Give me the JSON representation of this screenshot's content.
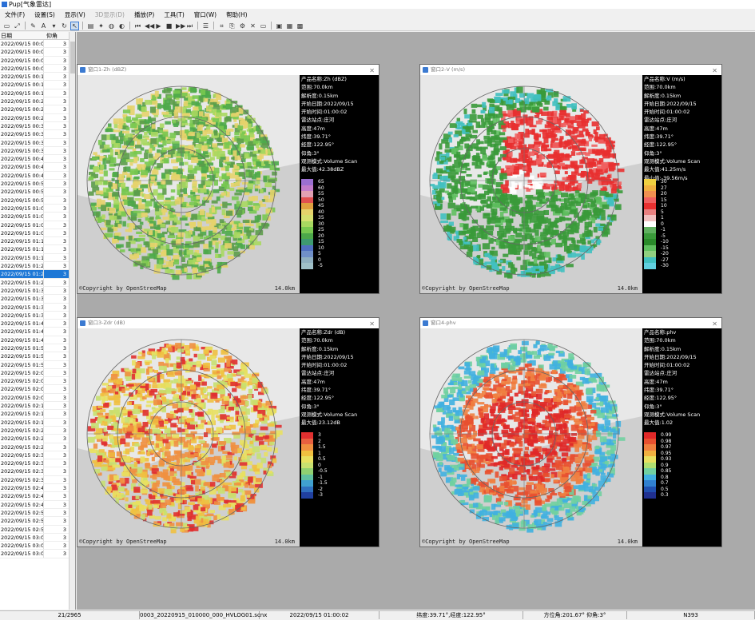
{
  "window_title": "Pup[气象雷达]",
  "menu": [
    "文件(F)",
    "设置(S)",
    "显示(V)",
    "3D显示(D)",
    "播放(P)",
    "工具(T)",
    "窗口(W)",
    "帮助(H)"
  ],
  "menu_disabled": [
    false,
    false,
    false,
    true,
    false,
    false,
    false,
    false
  ],
  "list": {
    "col_date": "日期",
    "col_elev": "仰角",
    "selected_index": 28,
    "rows": [
      [
        "2022/09/15 00:00",
        "3"
      ],
      [
        "2022/09/15 00:03",
        "3"
      ],
      [
        "2022/09/15 00:06",
        "3"
      ],
      [
        "2022/09/15 00:09",
        "3"
      ],
      [
        "2022/09/15 00:12",
        "3"
      ],
      [
        "2022/09/15 00:15",
        "3"
      ],
      [
        "2022/09/15 00:18",
        "3"
      ],
      [
        "2022/09/15 00:21",
        "3"
      ],
      [
        "2022/09/15 00:24",
        "3"
      ],
      [
        "2022/09/15 00:27",
        "3"
      ],
      [
        "2022/09/15 00:30",
        "3"
      ],
      [
        "2022/09/15 00:33",
        "3"
      ],
      [
        "2022/09/15 00:36",
        "3"
      ],
      [
        "2022/09/15 00:39",
        "3"
      ],
      [
        "2022/09/15 00:42",
        "3"
      ],
      [
        "2022/09/15 00:45",
        "3"
      ],
      [
        "2022/09/15 00:48",
        "3"
      ],
      [
        "2022/09/15 00:51",
        "3"
      ],
      [
        "2022/09/15 00:54",
        "3"
      ],
      [
        "2022/09/15 00:57",
        "3"
      ],
      [
        "2022/09/15 01:00",
        "3"
      ],
      [
        "2022/09/15 01:03",
        "3"
      ],
      [
        "2022/09/15 01:06",
        "3"
      ],
      [
        "2022/09/15 01:09",
        "3"
      ],
      [
        "2022/09/15 01:12",
        "3"
      ],
      [
        "2022/09/15 01:15",
        "3"
      ],
      [
        "2022/09/15 01:18",
        "3"
      ],
      [
        "2022/09/15 01:21",
        "3"
      ],
      [
        "2022/09/15 01:24",
        "3"
      ],
      [
        "2022/09/15 01:27",
        "3"
      ],
      [
        "2022/09/15 01:30",
        "3"
      ],
      [
        "2022/09/15 01:33",
        "3"
      ],
      [
        "2022/09/15 01:36",
        "3"
      ],
      [
        "2022/09/15 01:39",
        "3"
      ],
      [
        "2022/09/15 01:42",
        "3"
      ],
      [
        "2022/09/15 01:45",
        "3"
      ],
      [
        "2022/09/15 01:48",
        "3"
      ],
      [
        "2022/09/15 01:51",
        "3"
      ],
      [
        "2022/09/15 01:54",
        "3"
      ],
      [
        "2022/09/15 01:57",
        "3"
      ],
      [
        "2022/09/15 02:00",
        "3"
      ],
      [
        "2022/09/15 02:03",
        "3"
      ],
      [
        "2022/09/15 02:06",
        "3"
      ],
      [
        "2022/09/15 02:09",
        "3"
      ],
      [
        "2022/09/15 02:12",
        "3"
      ],
      [
        "2022/09/15 02:15",
        "3"
      ],
      [
        "2022/09/15 02:18",
        "3"
      ],
      [
        "2022/09/15 02:21",
        "3"
      ],
      [
        "2022/09/15 02:24",
        "3"
      ],
      [
        "2022/09/15 02:27",
        "3"
      ],
      [
        "2022/09/15 02:30",
        "3"
      ],
      [
        "2022/09/15 02:33",
        "3"
      ],
      [
        "2022/09/15 02:36",
        "3"
      ],
      [
        "2022/09/15 02:39",
        "3"
      ],
      [
        "2022/09/15 02:42",
        "3"
      ],
      [
        "2022/09/15 02:45",
        "3"
      ],
      [
        "2022/09/15 02:48",
        "3"
      ],
      [
        "2022/09/15 02:51",
        "3"
      ],
      [
        "2022/09/15 02:54",
        "3"
      ],
      [
        "2022/09/15 02:57",
        "3"
      ],
      [
        "2022/09/15 03:00",
        "3"
      ],
      [
        "2022/09/15 03:03",
        "3"
      ],
      [
        "2022/09/15 03:06",
        "3"
      ]
    ]
  },
  "windows": [
    {
      "title": "窗口1-Zh (dBZ)",
      "info": [
        "产品名称:Zh (dBZ)",
        "范围:70.0km",
        "解析度:0.15km",
        "开始日期:2022/09/15",
        "开始时间:01:00:02",
        "雷达站点:庄河",
        "高度:47m",
        "纬度:39.71°",
        "经度:122.95°",
        "仰角:3°",
        "观测模式:Volume Scan",
        "最大值:42.38dBZ"
      ],
      "legend": [
        [
          "#9b6fd0",
          "65"
        ],
        [
          "#c27cc9",
          "60"
        ],
        [
          "#e1a0b3",
          "55"
        ],
        [
          "#e05050",
          "50"
        ],
        [
          "#e0a040",
          "45"
        ],
        [
          "#e6d36b",
          "40"
        ],
        [
          "#d6e070",
          "35"
        ],
        [
          "#a8d860",
          "30"
        ],
        [
          "#78c850",
          "25"
        ],
        [
          "#4ca84a",
          "20"
        ],
        [
          "#3e9a70",
          "15"
        ],
        [
          "#5070c0",
          "10"
        ],
        [
          "#7090c8",
          "5"
        ],
        [
          "#90b0c0",
          "0"
        ],
        [
          "#a0c0c8",
          "-5"
        ]
      ],
      "copyright": "©Copyright by OpenStreeMap",
      "scale": "14.0km",
      "palette": [
        "#4ca84a",
        "#78c850",
        "#a8d860",
        "#e6d36b",
        "#5c9c4a"
      ]
    },
    {
      "title": "窗口2-V (m/s)",
      "info": [
        "产品名称:V (m/s)",
        "范围:70.0km",
        "解析度:0.15km",
        "开始日期:2022/09/15",
        "开始时间:01:00:02",
        "雷达站点:庄河",
        "高度:47m",
        "纬度:39.71°",
        "经度:122.95°",
        "仰角:3°",
        "观测模式:Volume Scan",
        "最大值:41.25m/s",
        "最小值:-39.56m/s"
      ],
      "legend": [
        [
          "#f0d040",
          "30"
        ],
        [
          "#f0b040",
          "27"
        ],
        [
          "#f09050",
          "20"
        ],
        [
          "#f06060",
          "15"
        ],
        [
          "#e83030",
          "10"
        ],
        [
          "#e88080",
          "5"
        ],
        [
          "#f0c0c0",
          "1"
        ],
        [
          "#ffffff",
          "0"
        ],
        [
          "#60b060",
          "-1"
        ],
        [
          "#3a9a3a",
          "-5"
        ],
        [
          "#2a8a2a",
          "-10"
        ],
        [
          "#60c060",
          "-15"
        ],
        [
          "#90d080",
          "-20"
        ],
        [
          "#40c0c0",
          "-27"
        ],
        [
          "#60d0e0",
          "-30"
        ]
      ],
      "copyright": "©Copyright by OpenStreeMap",
      "scale": "14.0km",
      "palette": [
        "#3a9a3a",
        "#2a8a2a",
        "#e83030",
        "#f06060",
        "#ffffff",
        "#40c0c0"
      ]
    },
    {
      "title": "窗口3-Zdr (dB)",
      "info": [
        "产品名称:Zdr (dB)",
        "范围:70.0km",
        "解析度:0.15km",
        "开始日期:2022/09/15",
        "开始时间:01:00:02",
        "雷达站点:庄河",
        "高度:47m",
        "纬度:39.71°",
        "经度:122.95°",
        "仰角:3°",
        "观测模式:Volume Scan",
        "最大值:23.12dB"
      ],
      "legend": [
        [
          "#e03030",
          "3"
        ],
        [
          "#e86040",
          "2"
        ],
        [
          "#f09040",
          "1.5"
        ],
        [
          "#f0c040",
          "1"
        ],
        [
          "#e8e060",
          "0.5"
        ],
        [
          "#c8e070",
          "0"
        ],
        [
          "#90d070",
          "-0.5"
        ],
        [
          "#60c0a0",
          "-1"
        ],
        [
          "#40a0d0",
          "-1.5"
        ],
        [
          "#3070c0",
          "-2"
        ],
        [
          "#2040a0",
          "-3"
        ]
      ],
      "copyright": "©Copyright by OpenStreeMap",
      "scale": "14.0km",
      "palette": [
        "#e8e060",
        "#f0c040",
        "#f09040",
        "#c8e070",
        "#e03030"
      ]
    },
    {
      "title": "窗口4-phv",
      "info": [
        "产品名称:phv",
        "范围:70.0km",
        "解析度:0.15km",
        "开始日期:2022/09/15",
        "开始时间:01:00:02",
        "雷达站点:庄河",
        "高度:47m",
        "纬度:39.71°",
        "经度:122.95°",
        "仰角:3°",
        "观测模式:Volume Scan",
        "最大值:1.02"
      ],
      "legend": [
        [
          "#e02828",
          "0.99"
        ],
        [
          "#e85030",
          "0.98"
        ],
        [
          "#f08040",
          "0.97"
        ],
        [
          "#f0b040",
          "0.95"
        ],
        [
          "#e8e060",
          "0.93"
        ],
        [
          "#b0e070",
          "0.9"
        ],
        [
          "#70d0a0",
          "0.85"
        ],
        [
          "#40b0e0",
          "0.8"
        ],
        [
          "#3080d0",
          "0.7"
        ],
        [
          "#2050b0",
          "0.5"
        ],
        [
          "#203090",
          "0.3"
        ]
      ],
      "copyright": "©Copyright by OpenStreeMap",
      "scale": "14.0km",
      "palette": [
        "#e02828",
        "#e85030",
        "#f08040",
        "#40b0e0",
        "#70d0a0"
      ]
    }
  ],
  "status": [
    "21/2965",
    "0003_20220915_010000_000_HVLOG01.scnx",
    "2022/09/15 01:00:02",
    "纬度:39.71°,经度:122.95°",
    "方位角:201.67° 仰角:3°",
    "N393"
  ]
}
